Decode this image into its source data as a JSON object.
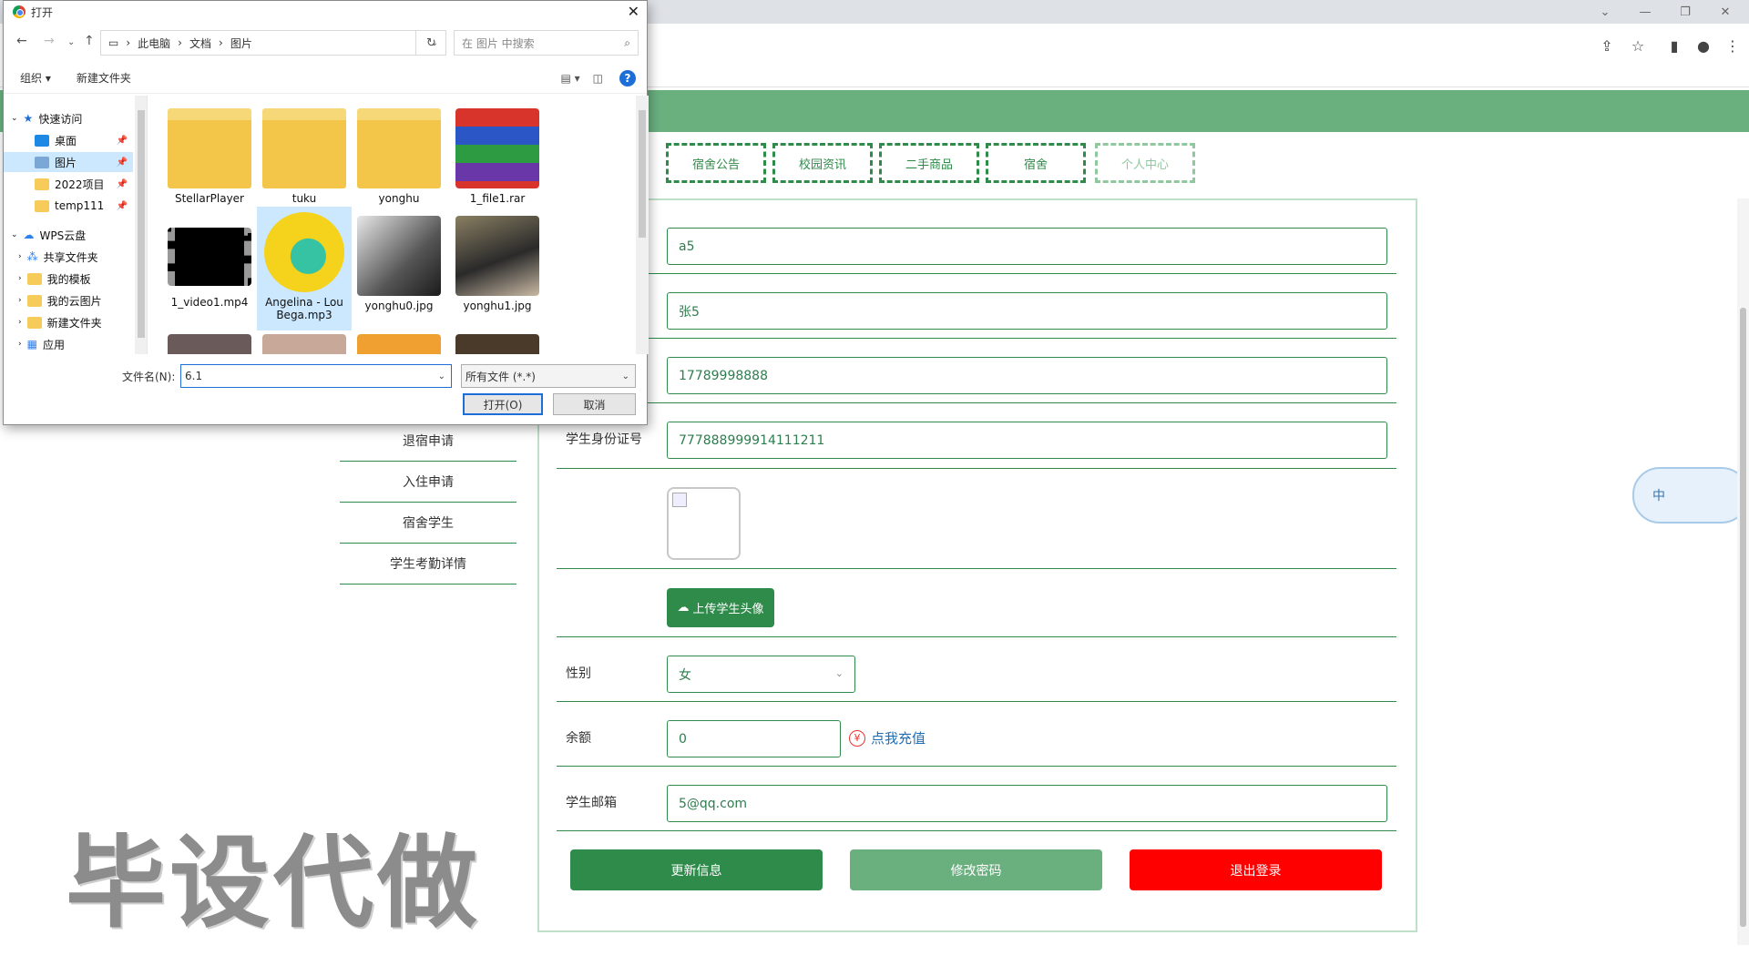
{
  "dialog": {
    "title": "打开",
    "path": [
      "此电脑",
      "文档",
      "图片"
    ],
    "search_placeholder": "在 图片 中搜索",
    "toolbar": {
      "organize": "组织",
      "new_folder": "新建文件夹",
      "help": "?"
    },
    "tree": [
      {
        "label": "快速访问",
        "type": "star"
      },
      {
        "label": "桌面",
        "type": "desktop"
      },
      {
        "label": "图片",
        "type": "pictures",
        "selected": true
      },
      {
        "label": "2022项目",
        "type": "folder"
      },
      {
        "label": "temp111",
        "type": "folder"
      },
      {
        "label": "WPS云盘",
        "type": "cloud"
      },
      {
        "label": "共享文件夹",
        "type": "share"
      },
      {
        "label": "我的模板",
        "type": "folder"
      },
      {
        "label": "我的云图片",
        "type": "folder"
      },
      {
        "label": "新建文件夹",
        "type": "folder"
      },
      {
        "label": "应用",
        "type": "apps"
      }
    ],
    "files": [
      {
        "name": "StellarPlayer",
        "kind": "folder"
      },
      {
        "name": "tuku",
        "kind": "folder"
      },
      {
        "name": "yonghu",
        "kind": "folder"
      },
      {
        "name": "1_file1.rar",
        "kind": "rar"
      },
      {
        "name": "1_video1.mp4",
        "kind": "video"
      },
      {
        "name": "Angelina - Lou Bega.mp3",
        "kind": "music",
        "selected": true
      },
      {
        "name": "yonghu0.jpg",
        "kind": "photo"
      },
      {
        "name": "yonghu1.jpg",
        "kind": "photo"
      }
    ],
    "filename_label": "文件名(N):",
    "filename_value": "6.1",
    "filetype": "所有文件 (*.*)",
    "open_button": "打开(O)",
    "cancel_button": "取消"
  },
  "nav_tabs": [
    {
      "label": "宿舍公告"
    },
    {
      "label": "校园资讯"
    },
    {
      "label": "二手商品"
    },
    {
      "label": "宿舍"
    },
    {
      "label": "个人中心",
      "dim": true
    }
  ],
  "sidebar": [
    "退宿申请",
    "入住申请",
    "宿舍学生",
    "学生考勤详情"
  ],
  "form": {
    "account": "a5",
    "name": "张5",
    "phone": "17789998888",
    "id_label": "学生身份证号",
    "id_value": "777888999914111211",
    "upload_button": "上传学生头像",
    "gender_label": "性别",
    "gender_value": "女",
    "balance_label": "余额",
    "balance_value": "0",
    "recharge_link": "点我充值",
    "email_label": "学生邮箱",
    "email_value": "5@qq.com"
  },
  "buttons": {
    "update": "更新信息",
    "change_password": "修改密码",
    "logout": "退出登录"
  },
  "colors": {
    "primary_green": "#2e8b4a",
    "light_green": "#6ab07f",
    "logout_red": "#ff0000"
  },
  "watermark": "毕设代做",
  "ime_indicator": "中"
}
